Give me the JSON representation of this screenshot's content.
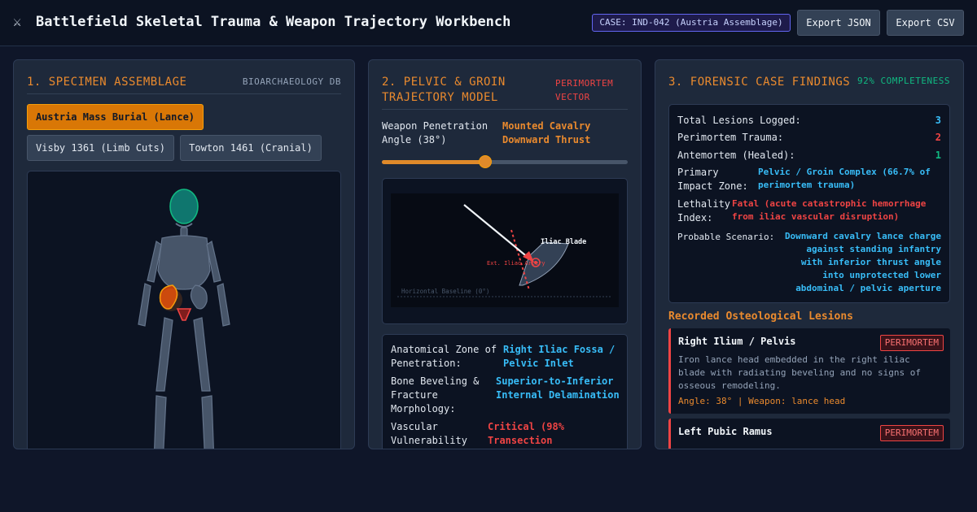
{
  "header": {
    "title": "Battlefield Skeletal Trauma & Weapon Trajectory Workbench",
    "icon": "crossed-swords-icon",
    "case_badge": "CASE: IND-042 (Austria Assemblage)",
    "export_json": "Export JSON",
    "export_csv": "Export CSV"
  },
  "assemblage": {
    "title": "1. SPECIMEN ASSEMBLAGE",
    "tag": "BIOARCHAEOLOGY DB",
    "options": [
      {
        "label": "Austria Mass Burial (Lance)",
        "active": true
      },
      {
        "label": "Visby 1361 (Limb Cuts)",
        "active": false
      },
      {
        "label": "Towton 1461 (Cranial)",
        "active": false
      }
    ]
  },
  "trajectory": {
    "title": "2. PELVIC & GROIN TRAJECTORY MODEL",
    "tag": "PERIMORTEM VECTOR",
    "angle_label": "Weapon Penetration Angle (38°)",
    "angle_value_label": "Mounted Cavalry Downward Thrust",
    "slider_fraction": 0.42,
    "diagram": {
      "bone_label": "Iliac Blade",
      "artery_label": "Ext. Iliac Artery",
      "baseline_label": "Horizontal Baseline (0°)"
    },
    "details": [
      {
        "label": "Anatomical Zone of Penetration:",
        "value": "Right Iliac Fossa / Pelvic Inlet",
        "color": "#38bdf8"
      },
      {
        "label": "Bone Beveling & Fracture Morphology:",
        "value": "Superior-to-Inferior Internal Delamination",
        "color": "#38bdf8"
      },
      {
        "label": "Vascular Vulnerability",
        "value": "Critical (98% Transection",
        "color": "#ef4444"
      }
    ]
  },
  "findings": {
    "title": "3. FORENSIC CASE FINDINGS",
    "completeness": "92% COMPLETENESS",
    "stats": [
      {
        "label": "Total Lesions Logged:",
        "value": "3",
        "color": "#38bdf8"
      },
      {
        "label": "Perimortem Trauma:",
        "value": "2",
        "color": "#ef4444"
      },
      {
        "label": "Antemortem (Healed):",
        "value": "1",
        "color": "#10b981"
      }
    ],
    "primary_zone_label": "Primary Impact Zone:",
    "primary_zone_value": "Pelvic / Groin Complex (66.7% of perimortem trauma)",
    "lethality_label": "Lethality Index:",
    "lethality_value": "Fatal (acute catastrophic hemorrhage from iliac vascular disruption)",
    "scenario_label": "Probable Scenario:",
    "scenario_value": "Downward cavalry lance charge against standing infantry with inferior thrust angle into unprotected lower abdominal / pelvic aperture",
    "lesions_heading": "Recorded Osteological Lesions",
    "lesions": [
      {
        "name": "Right Ilium / Pelvis",
        "badge": "PERIMORTEM",
        "description": "Iron lance head embedded in the right iliac blade with radiating beveling and no signs of osseous remodeling.",
        "meta": "Angle: 38° | Weapon: lance head"
      },
      {
        "name": "Left Pubic Ramus",
        "badge": "PERIMORTEM",
        "description": "",
        "meta": ""
      }
    ]
  },
  "colors": {
    "accent": "#ea8a2e",
    "perimortem": "#ef4444",
    "healed": "#10b981",
    "info": "#38bdf8"
  }
}
